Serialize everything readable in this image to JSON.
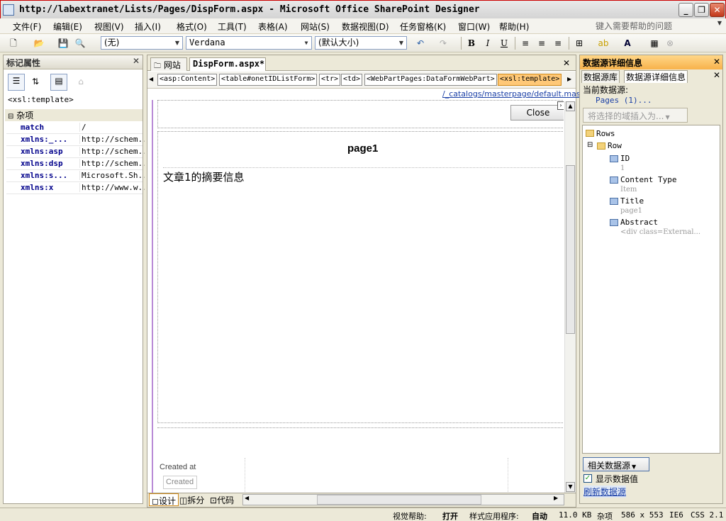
{
  "window": {
    "title": "http://labextranet/Lists/Pages/DispForm.aspx - Microsoft Office SharePoint Designer"
  },
  "menu": {
    "items": [
      "文件(F)",
      "编辑(E)",
      "视图(V)",
      "插入(I)",
      "格式(O)",
      "工具(T)",
      "表格(A)",
      "网站(S)",
      "数据视图(D)",
      "任务窗格(K)",
      "窗口(W)",
      "帮助(H)"
    ],
    "help_placeholder": "键入需要帮助的问题"
  },
  "toolbar": {
    "style_value": "(无)",
    "font_value": "Verdana",
    "size_value": "(默认大小)"
  },
  "left_panel": {
    "title": "标记属性",
    "current_tag": "<xsl:template>",
    "category": "杂项",
    "properties": [
      {
        "key": "match",
        "value": "/"
      },
      {
        "key": "xmlns:_...",
        "value": "http://schem..."
      },
      {
        "key": "xmlns:asp",
        "value": "http://schem..."
      },
      {
        "key": "xmlns:dsp",
        "value": "http://schem..."
      },
      {
        "key": "xmlns:s...",
        "value": "Microsoft.Sh..."
      },
      {
        "key": "xmlns:x",
        "value": "http://www.w..."
      }
    ]
  },
  "center": {
    "tabs": [
      "网站",
      "DispForm.aspx*"
    ],
    "breadcrumbs": [
      "<asp:Content>",
      "<table#onetIDListForm>",
      "<tr>",
      "<td>",
      "<WebPartPages:DataFormWebPart>",
      "<xsl:template>"
    ],
    "master_link": "/_catalogs/masterpage/default.master",
    "close_label": "Close",
    "page_title": "page1",
    "abstract_text": "文章1的摘要信息",
    "created_at_label": "Created at",
    "created_field": "Created",
    "view_tabs": [
      "设计",
      "拆分",
      "代码"
    ]
  },
  "right_panel": {
    "title": "数据源详细信息",
    "tabs": [
      "数据源库",
      "数据源详细信息"
    ],
    "current_source_label": "当前数据源:",
    "current_source_value": "Pages (1)...",
    "insert_button": "将选择的域插入为...",
    "tree": {
      "root": "Rows",
      "row": "Row",
      "fields": [
        {
          "name": "ID",
          "value": "1"
        },
        {
          "name": "Content Type",
          "value": "Item"
        },
        {
          "name": "Title",
          "value": "page1"
        },
        {
          "name": "Abstract",
          "value": "<div class=External..."
        }
      ]
    },
    "related_button": "相关数据源",
    "show_values_label": "显示数据值",
    "refresh_link": "刷新数据源"
  },
  "status": {
    "visual_aid_label": "视觉帮助:",
    "visual_aid_value": "打开",
    "style_app_label": "样式应用程序:",
    "style_app_value": "自动",
    "file_size": "11.0 KB",
    "misc": "杂项",
    "dimensions": "586 x 553",
    "browser": "IE6",
    "css": "CSS 2.1"
  }
}
